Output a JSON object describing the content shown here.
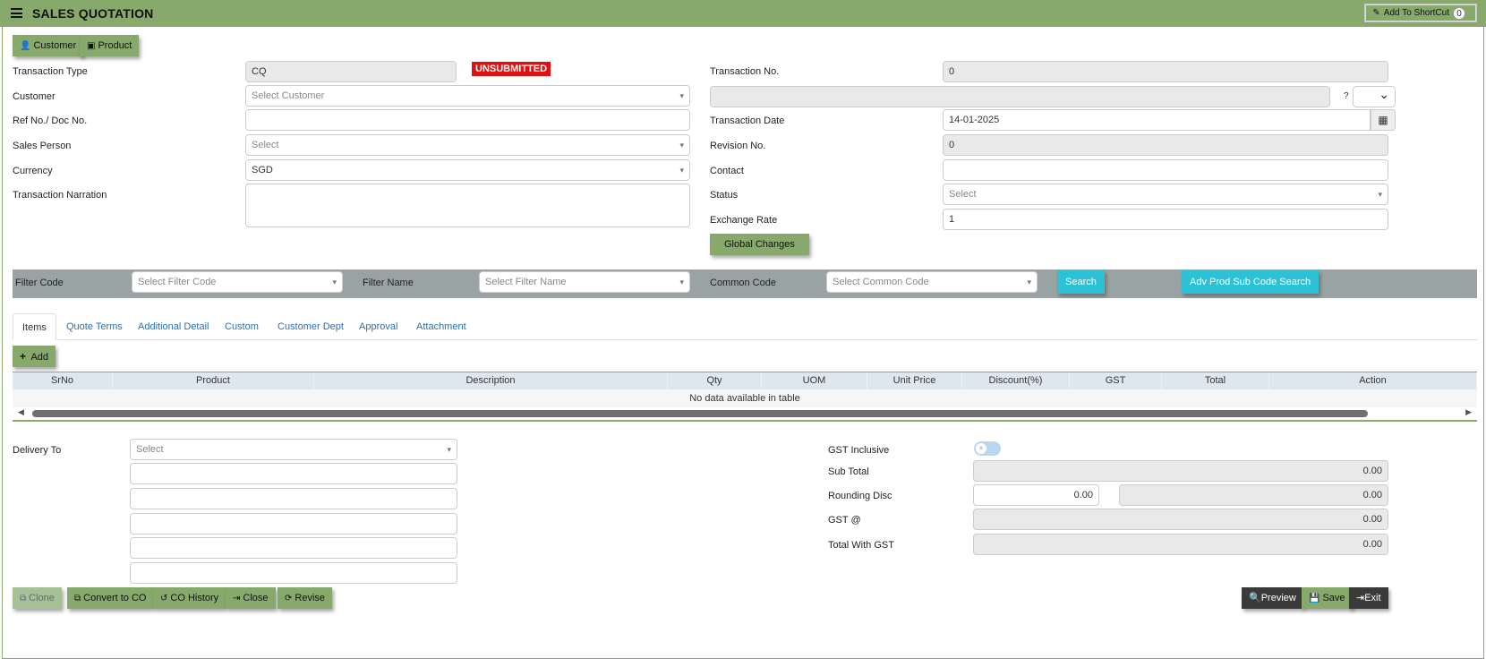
{
  "header": {
    "title": "SALES QUOTATION",
    "shortcut_label": "Add To ShortCut",
    "shortcut_count": "0"
  },
  "top_buttons": {
    "customer": "Customer",
    "product": "Product"
  },
  "status_badge": "UNSUBMITTED",
  "left_form": {
    "transaction_type": {
      "label": "Transaction Type",
      "value": "CQ"
    },
    "customer": {
      "label": "Customer",
      "placeholder": "Select Customer"
    },
    "ref_no": {
      "label": "Ref No./ Doc No.",
      "value": ""
    },
    "sales_person": {
      "label": "Sales Person",
      "placeholder": "Select"
    },
    "currency": {
      "label": "Currency",
      "value": "SGD"
    },
    "narration": {
      "label": "Transaction Narration",
      "value": ""
    }
  },
  "right_form": {
    "transaction_no": {
      "label": "Transaction No.",
      "value": "0"
    },
    "customer_name": {
      "value": ""
    },
    "question_mark": "?",
    "transaction_date": {
      "label": "Transaction Date",
      "value": "14-01-2025"
    },
    "revision_no": {
      "label": "Revision No.",
      "value": "0"
    },
    "contact": {
      "label": "Contact",
      "value": ""
    },
    "status": {
      "label": "Status",
      "placeholder": "Select"
    },
    "exchange_rate": {
      "label": "Exchange Rate",
      "value": "1"
    },
    "global_changes": "Global Changes"
  },
  "filter_bar": {
    "filter_code_label": "Filter Code",
    "filter_code_placeholder": "Select Filter Code",
    "filter_name_label": "Filter Name",
    "filter_name_placeholder": "Select Filter Name",
    "common_code_label": "Common Code",
    "common_code_placeholder": "Select Common Code",
    "search": "Search",
    "adv_search": "Adv Prod Sub Code Search"
  },
  "tabs": [
    "Items",
    "Quote Terms",
    "Additional Detail",
    "Custom",
    "Customer Dept",
    "Approval",
    "Attachment"
  ],
  "add_button": "Add",
  "grid": {
    "columns": [
      "SrNo",
      "Product",
      "Description",
      "Qty",
      "UOM",
      "Unit Price",
      "Discount(%)",
      "GST",
      "Total",
      "Action"
    ],
    "empty_message": "No data available in table"
  },
  "delivery": {
    "label": "Delivery To",
    "placeholder": "Select"
  },
  "totals": {
    "gst_inclusive": "GST Inclusive",
    "sub_total": {
      "label": "Sub Total",
      "value": "0.00"
    },
    "rounding_disc": {
      "label": "Rounding Disc",
      "value": "0.00",
      "value2": "0.00"
    },
    "gst_at": {
      "label": "GST @",
      "value": "0.00"
    },
    "total_with_gst": {
      "label": "Total With GST",
      "value": "0.00"
    }
  },
  "footer_buttons": {
    "clone": "Clone",
    "convert": "Convert to CO",
    "co_history": "CO History",
    "close": "Close",
    "revise": "Revise",
    "preview": "Preview",
    "save": "Save",
    "exit": "Exit"
  },
  "colors": {
    "header_green": "#87a96b",
    "filter_gray": "#9aa3a3",
    "teal": "#2cc1d6",
    "badge_red": "#e01010"
  }
}
